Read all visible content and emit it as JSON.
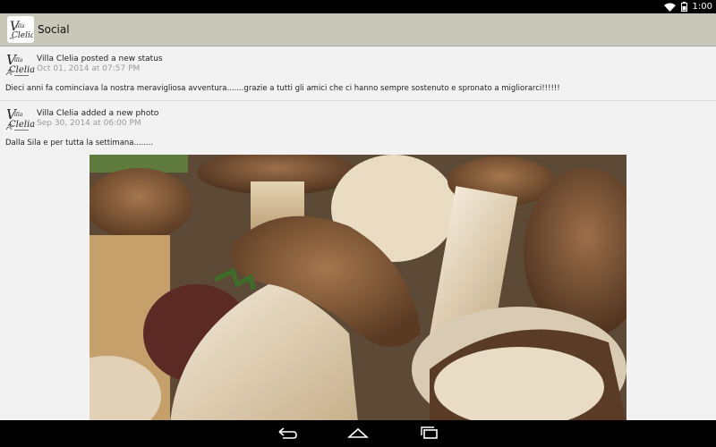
{
  "status_bar": {
    "time": "1:00"
  },
  "app_bar": {
    "title": "Social",
    "logo_text": "Villa Clelia"
  },
  "posts": [
    {
      "author": "Villa Clelia",
      "action": "posted a new status",
      "date": "Oct 01, 2014 at 07:57 PM",
      "text": "Dieci anni fa cominciava la nostra meravigliosa avventura.......grazie a tutti gli amici che ci hanno sempre sostenuto e spronato a migliorarci!!!!!!"
    },
    {
      "author": "Villa Clelia",
      "action": "added a new photo",
      "date": "Sep 30, 2014 at 06:00 PM",
      "text": "Dalla Sila e per tutta la settimana........"
    }
  ],
  "icons": {
    "wifi": "wifi-icon",
    "battery": "battery-icon",
    "back": "back-icon",
    "home": "home-icon",
    "recents": "recents-icon"
  }
}
